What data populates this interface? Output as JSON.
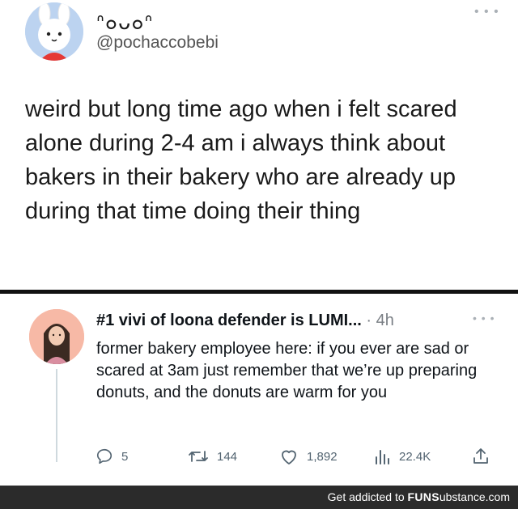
{
  "original_tweet": {
    "display_name": "ᐢ๐ᴗ๐ᐢ",
    "handle": "@pochaccobebi",
    "text": "weird but long time ago when i felt scared alone during 2-4 am i always think about bakers in their bakery who are already up during that time doing their thing",
    "more_icon": "more-dots-icon"
  },
  "reply_tweet": {
    "display_name": "#1 vivi of loona defender is LUMI...",
    "separator": "·",
    "time": "4h",
    "text": "former bakery employee here: if you ever are sad or scared at 3am just remember that we’re up preparing donuts, and the donuts are warm for you",
    "actions": {
      "replies": "5",
      "retweets": "144",
      "likes": "1,892",
      "views": "22.4K"
    }
  },
  "banner": {
    "prefix": "Get addicted to ",
    "brand_bold": "FUNS",
    "brand_rest": "ubstance.com"
  },
  "colors": {
    "accent_gray": "#536471",
    "divider": "#111111",
    "banner_bg": "#2b2b2b"
  }
}
